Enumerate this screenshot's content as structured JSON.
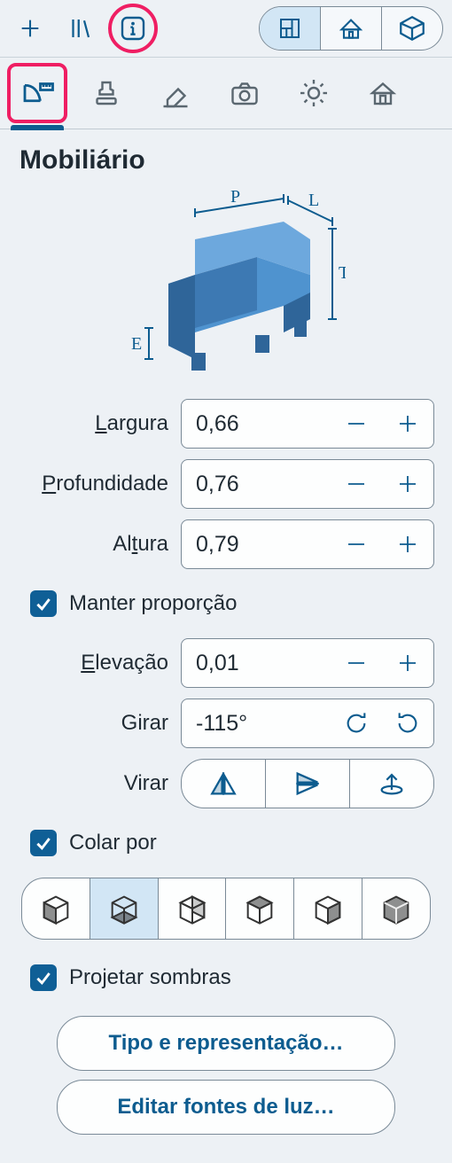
{
  "section_title": "Mobiliário",
  "diagram_labels": {
    "p": "P",
    "l": "L",
    "t": "T",
    "e": "E"
  },
  "props": {
    "width": {
      "label_pre": "",
      "label_ul": "L",
      "label_post": "argura",
      "value": "0,66"
    },
    "depth": {
      "label_pre": "",
      "label_ul": "P",
      "label_post": "rofundidade",
      "value": "0,76"
    },
    "height": {
      "label_pre": "Al",
      "label_ul": "t",
      "label_post": "ura",
      "value": "0,79"
    },
    "elev": {
      "label_pre": "",
      "label_ul": "E",
      "label_post": "levação",
      "value": "0,01"
    },
    "rotate": {
      "label": "Girar",
      "value": "-115°"
    },
    "mirror": {
      "label": "Virar"
    }
  },
  "checks": {
    "keep_ratio": "Manter proporção",
    "paste_by": "Colar por",
    "cast_shadows": "Projetar sombras"
  },
  "buttons": {
    "type_repr": "Tipo e representação…",
    "edit_lights": "Editar fontes de luz…"
  }
}
